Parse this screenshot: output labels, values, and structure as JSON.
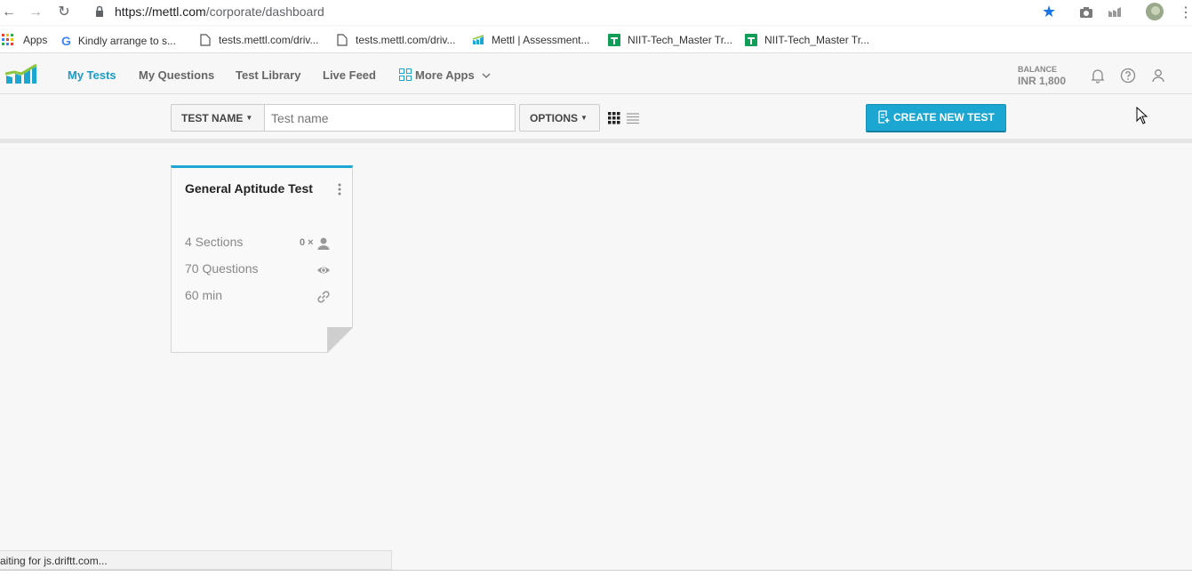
{
  "browser": {
    "url_host": "https://mettl.com",
    "url_path": "/corporate/dashboard",
    "bookmarks": [
      {
        "label": "Apps"
      },
      {
        "label": "Kindly arrange to s..."
      },
      {
        "label": "tests.mettl.com/driv..."
      },
      {
        "label": "tests.mettl.com/driv..."
      },
      {
        "label": "Mettl | Assessment..."
      },
      {
        "label": "NIIT-Tech_Master Tr..."
      },
      {
        "label": "NIIT-Tech_Master Tr..."
      }
    ],
    "status_text": "aiting for js.driftt.com..."
  },
  "app": {
    "nav": [
      {
        "label": "My Tests",
        "active": true
      },
      {
        "label": "My Questions"
      },
      {
        "label": "Test Library"
      },
      {
        "label": "Live Feed"
      },
      {
        "label": "More Apps"
      }
    ],
    "balance_label": "BALANCE",
    "balance_value": "INR 1,800"
  },
  "toolbar": {
    "filter_label": "TEST NAME",
    "search_placeholder": "Test name",
    "options_label": "OPTIONS",
    "create_label": "CREATE NEW TEST"
  },
  "tests": [
    {
      "title": "General Aptitude Test",
      "sections": "4 Sections",
      "questions": "70 Questions",
      "duration": "60 min",
      "candidates": "0 ×"
    }
  ],
  "colors": {
    "accent": "#1ba7d1",
    "nav_active": "#1a9bc8"
  }
}
